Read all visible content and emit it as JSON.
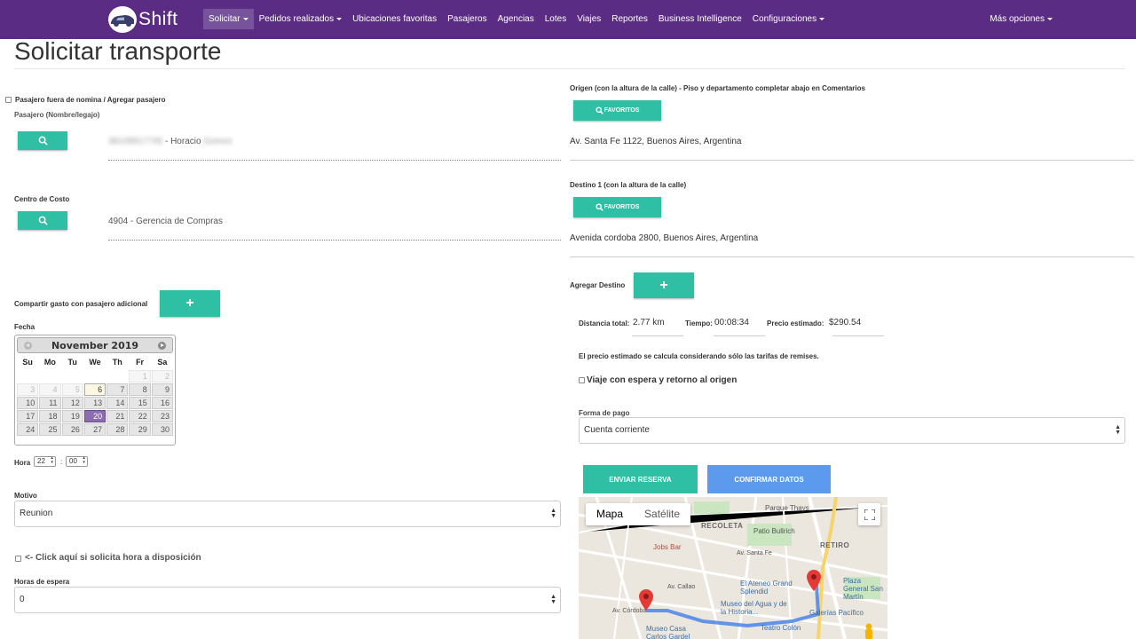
{
  "brand": {
    "name": "Shift"
  },
  "nav": {
    "items": [
      {
        "label": "Solicitar",
        "dropdown": true,
        "active": true
      },
      {
        "label": "Pedidos realizados",
        "dropdown": true
      },
      {
        "label": "Ubicaciones favoritas"
      },
      {
        "label": "Pasajeros"
      },
      {
        "label": "Agencias"
      },
      {
        "label": "Lotes"
      },
      {
        "label": "Viajes"
      },
      {
        "label": "Reportes"
      },
      {
        "label": "Business Intelligence"
      },
      {
        "label": "Configuraciones",
        "dropdown": true
      }
    ],
    "more": "Más opciones"
  },
  "page": {
    "title": "Solicitar transporte"
  },
  "left": {
    "pasajero_fuera": "Pasajero fuera de nomina / Agregar pasajero",
    "pasajero_label": "Pasajero (Nombre/legajo)",
    "pasajero_legajo": "38109917745",
    "pasajero_nombre_prefix": "- Horacio",
    "pasajero_apellido": "Gomez",
    "centro_costo_label": "Centro de Costo",
    "centro_costo_value": "4904 - Gerencia de Compras",
    "compartir_label": "Compartir gasto con pasajero adicional",
    "fecha_label": "Fecha",
    "calendar": {
      "month": "November 2019",
      "dows": [
        "Su",
        "Mo",
        "Tu",
        "We",
        "Th",
        "Fr",
        "Sa"
      ],
      "days": [
        "",
        "",
        "",
        "",
        "",
        "1",
        "2",
        "3",
        "4",
        "5",
        "6",
        "7",
        "8",
        "9",
        "10",
        "11",
        "12",
        "13",
        "14",
        "15",
        "16",
        "17",
        "18",
        "19",
        "20",
        "21",
        "22",
        "23",
        "24",
        "25",
        "26",
        "27",
        "28",
        "29",
        "30"
      ],
      "today": "6",
      "selected": "20",
      "first_enabled": "6"
    },
    "hora_label": "Hora",
    "hora_h": "22",
    "hora_sep": ":",
    "hora_m": "00",
    "motivo_label": "Motivo",
    "motivo_value": "Reunion",
    "disposicion_label": "<- Click aquí si solicita hora a disposición",
    "horas_espera_label": "Horas de espera",
    "horas_espera_value": "0"
  },
  "right": {
    "origen_label": "Origen (con la altura de la calle) - Piso y departamento completar abajo en Comentarios",
    "favoritos_label": "FAVORITOS",
    "origen_value": "Av. Santa Fe 1122, Buenos Aires, Argentina",
    "destino_label": "Destino 1 (con la altura de la calle)",
    "destino_value": "Avenida cordoba 2800, Buenos Aires, Argentina",
    "agregar_destino": "Agregar Destino",
    "distancia_label": "Distancia total:",
    "distancia_value": "2.77 km",
    "tiempo_label": "Tiempo:",
    "tiempo_value": "00:08:34",
    "precio_label": "Precio estimado:",
    "precio_value": "$290.54",
    "precio_note": "El precio estimado se calcula considerando sólo las tarifas de remises.",
    "espera_label": "Viaje con espera y retorno al origen",
    "forma_pago_label": "Forma de pago",
    "forma_pago_value": "Cuenta corriente",
    "enviar_label": "ENVIAR RESERVA",
    "confirmar_label": "CONFIRMAR DATOS"
  },
  "map": {
    "tab_mapa": "Mapa",
    "tab_satelite": "Satélite",
    "labels": [
      "Parque Thays",
      "RECOLETA",
      "Patio Bullrich",
      "RETIRO",
      "Jobs Bar",
      "El Ateneo Grand Splendid",
      "Museo del Agua y de la Historia...",
      "Plaza General San Martín",
      "Galerías Pacífico",
      "Teatro Colón",
      "Museo Casa Carlos Gardel",
      "Av. Córdoba",
      "Av. Callao",
      "Av. Santa Fe"
    ]
  },
  "colors": {
    "nav": "#5b2c83",
    "teal": "#2ebfa5",
    "blue": "#5b9aec",
    "calendar_selected": "#8d6db1"
  }
}
